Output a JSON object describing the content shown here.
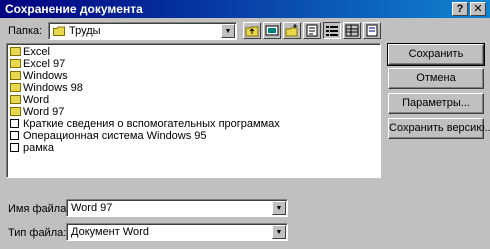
{
  "window": {
    "title": "Сохранение документа",
    "help_label": "?",
    "close_label": "✕"
  },
  "location": {
    "label": "Папка:",
    "value": "Труды"
  },
  "toolbar": {
    "icons": [
      "up-folder-icon",
      "desktop-icon",
      "new-folder-icon",
      "favorites-icon",
      "list-view-icon",
      "details-view-icon",
      "properties-icon"
    ]
  },
  "files": [
    {
      "name": "Excel",
      "type": "folder"
    },
    {
      "name": "Excel 97",
      "type": "folder"
    },
    {
      "name": "Windows",
      "type": "folder"
    },
    {
      "name": "Windows 98",
      "type": "folder"
    },
    {
      "name": "Word",
      "type": "folder"
    },
    {
      "name": "Word 97",
      "type": "folder"
    },
    {
      "name": "Краткие сведения о вспомогательных программах",
      "type": "document"
    },
    {
      "name": "Операционная система Windows 95",
      "type": "document"
    },
    {
      "name": "рамка",
      "type": "document"
    }
  ],
  "buttons": {
    "save": "Сохранить",
    "cancel": "Отмена",
    "options": "Параметры...",
    "save_version": "Сохранить версию..."
  },
  "filename": {
    "label": "Имя файла:",
    "value": "Word 97"
  },
  "filetype": {
    "label": "Тип файла:",
    "value": "Документ Word"
  },
  "colors": {
    "title_bar": "#000080",
    "dialog_bg": "#c0c0c0",
    "folder": "#e8d850"
  }
}
